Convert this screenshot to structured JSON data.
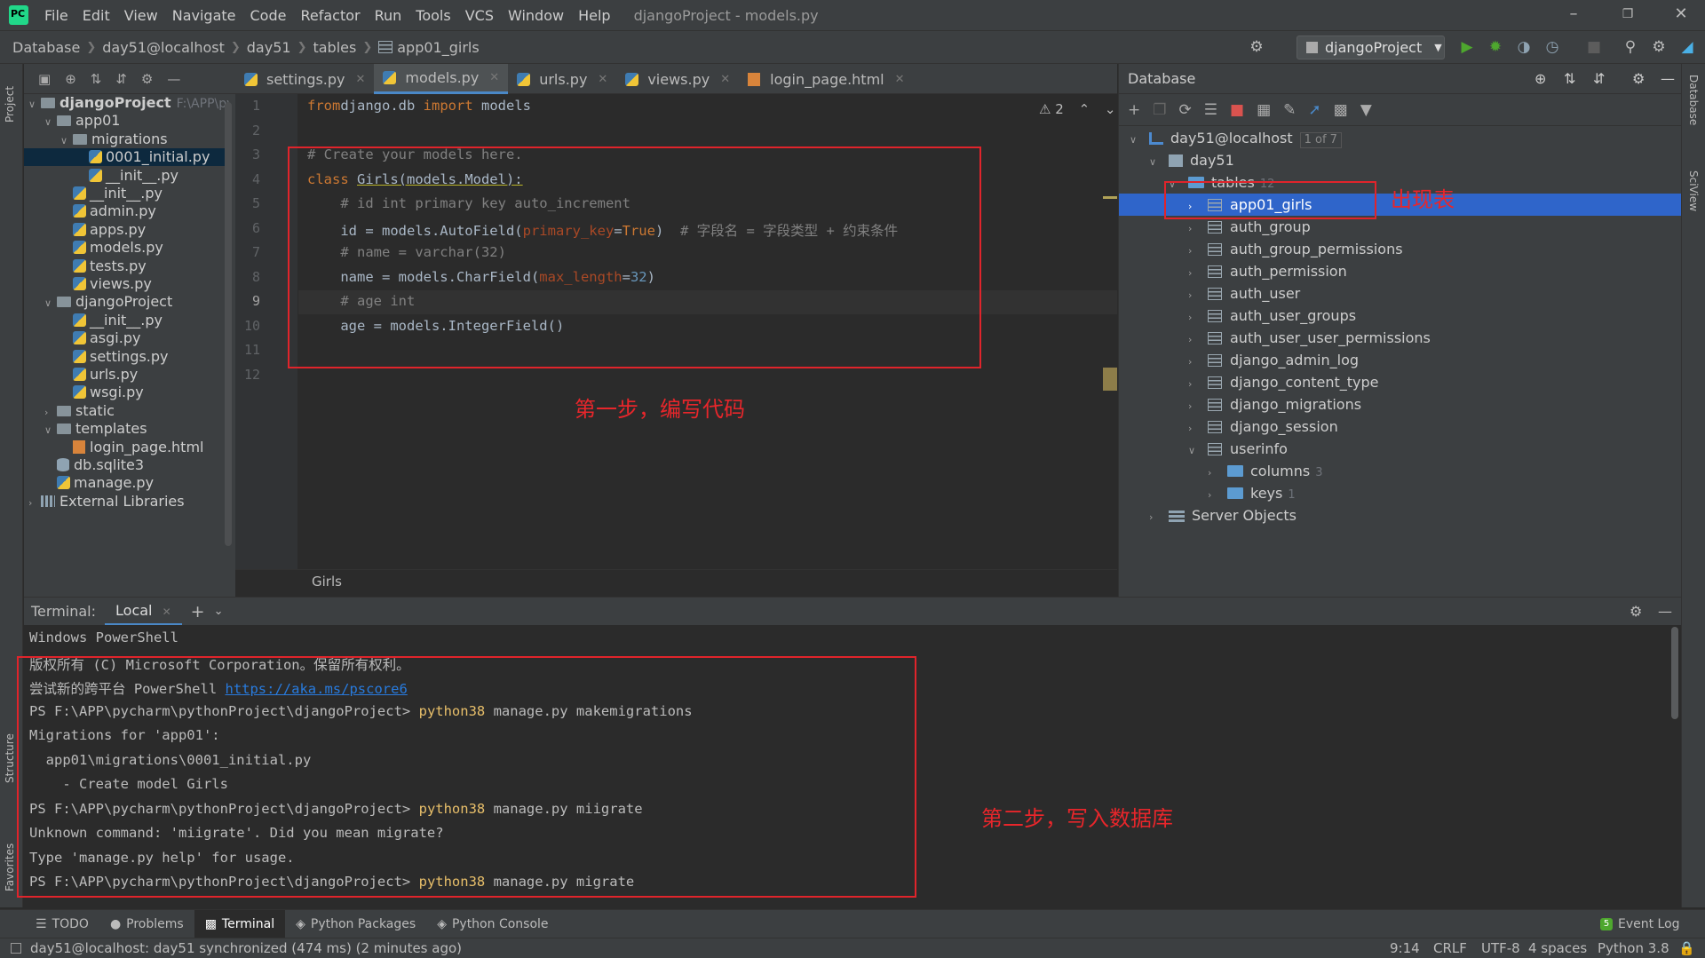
{
  "app": {
    "menu": [
      "File",
      "Edit",
      "View",
      "Navigate",
      "Code",
      "Refactor",
      "Run",
      "Tools",
      "VCS",
      "Window",
      "Help"
    ],
    "window_title": "djangoProject - models.py"
  },
  "navbar": {
    "crumbs": [
      "Database",
      "day51@localhost",
      "day51",
      "tables",
      "app01_girls"
    ],
    "run_config": "djangoProject"
  },
  "left_stripe": {
    "project": "Project",
    "structure": "Structure",
    "favorites": "Favorites"
  },
  "right_stripe": {
    "database": "Database",
    "sciview": "SciView"
  },
  "project_tree": [
    {
      "label": "djangoProject",
      "suffix": "F:\\APP\\py",
      "icon": "folder-icon",
      "arrow": "v",
      "indent": 0,
      "bold": true
    },
    {
      "label": "app01",
      "icon": "folder-icon",
      "arrow": "v",
      "indent": 1
    },
    {
      "label": "migrations",
      "icon": "folder-icon",
      "arrow": "v",
      "indent": 2
    },
    {
      "label": "0001_initial.py",
      "icon": "python-file-icon",
      "arrow": "",
      "indent": 3,
      "selected": true
    },
    {
      "label": "__init__.py",
      "icon": "python-file-icon",
      "arrow": "",
      "indent": 3
    },
    {
      "label": "__init__.py",
      "icon": "python-file-icon",
      "arrow": "",
      "indent": 2
    },
    {
      "label": "admin.py",
      "icon": "python-file-icon",
      "arrow": "",
      "indent": 2
    },
    {
      "label": "apps.py",
      "icon": "python-file-icon",
      "arrow": "",
      "indent": 2
    },
    {
      "label": "models.py",
      "icon": "python-file-icon",
      "arrow": "",
      "indent": 2
    },
    {
      "label": "tests.py",
      "icon": "python-file-icon",
      "arrow": "",
      "indent": 2
    },
    {
      "label": "views.py",
      "icon": "python-file-icon",
      "arrow": "",
      "indent": 2
    },
    {
      "label": "djangoProject",
      "icon": "folder-icon",
      "arrow": "v",
      "indent": 1
    },
    {
      "label": "__init__.py",
      "icon": "python-file-icon",
      "arrow": "",
      "indent": 2
    },
    {
      "label": "asgi.py",
      "icon": "python-file-icon",
      "arrow": "",
      "indent": 2
    },
    {
      "label": "settings.py",
      "icon": "python-file-icon",
      "arrow": "",
      "indent": 2
    },
    {
      "label": "urls.py",
      "icon": "python-file-icon",
      "arrow": "",
      "indent": 2
    },
    {
      "label": "wsgi.py",
      "icon": "python-file-icon",
      "arrow": "",
      "indent": 2
    },
    {
      "label": "static",
      "icon": "folder-icon",
      "arrow": ">",
      "indent": 1
    },
    {
      "label": "templates",
      "icon": "folder-icon",
      "arrow": "v",
      "indent": 1
    },
    {
      "label": "login_page.html",
      "icon": "html-file-icon",
      "arrow": "",
      "indent": 2
    },
    {
      "label": "db.sqlite3",
      "icon": "database-file-icon",
      "arrow": "",
      "indent": 1
    },
    {
      "label": "manage.py",
      "icon": "python-file-icon",
      "arrow": "",
      "indent": 1
    },
    {
      "label": "External Libraries",
      "icon": "library-icon",
      "arrow": ">",
      "indent": 0
    }
  ],
  "editor": {
    "tabs": [
      {
        "label": "settings.py",
        "active": false
      },
      {
        "label": "models.py",
        "active": true
      },
      {
        "label": "urls.py",
        "active": false
      },
      {
        "label": "views.py",
        "active": false
      },
      {
        "label": "login_page.html",
        "active": false
      }
    ],
    "warning_count": "2",
    "current_line": "9",
    "breadcrumb": "Girls",
    "lines": [
      {
        "n": "1",
        "parts": [
          [
            "kw",
            "from"
          ],
          [
            "",
            "django.db "
          ],
          [
            "kw",
            "import"
          ],
          [
            "",
            " models"
          ]
        ]
      },
      {
        "n": "2",
        "parts": []
      },
      {
        "n": "3",
        "parts": [
          [
            "cm",
            "# Create your models here."
          ]
        ]
      },
      {
        "n": "4",
        "parts": [
          [
            "kw",
            "class "
          ],
          [
            "cls",
            "Girls(models.Model):"
          ]
        ]
      },
      {
        "n": "5",
        "parts": [
          [
            "cm",
            "    # id int primary key auto_increment"
          ]
        ]
      },
      {
        "n": "6",
        "parts": [
          [
            "",
            "    id = models.AutoField("
          ],
          [
            "param",
            "primary_key"
          ],
          [
            "",
            "="
          ],
          [
            "kw",
            "True"
          ],
          [
            "",
            ")  "
          ],
          [
            "cm",
            "# 字段名 = 字段类型 + 约束条件"
          ]
        ]
      },
      {
        "n": "7",
        "parts": [
          [
            "cm",
            "    # name = varchar(32)"
          ]
        ]
      },
      {
        "n": "8",
        "parts": [
          [
            "",
            "    name = models.CharField("
          ],
          [
            "param",
            "max_length"
          ],
          [
            "",
            "="
          ],
          [
            "num",
            "32"
          ],
          [
            "",
            ")"
          ]
        ]
      },
      {
        "n": "9",
        "parts": [
          [
            "cm",
            "    # age int"
          ]
        ]
      },
      {
        "n": "10",
        "parts": [
          [
            "",
            "    age = models.IntegerField()"
          ]
        ]
      },
      {
        "n": "11",
        "parts": []
      },
      {
        "n": "12",
        "parts": []
      }
    ]
  },
  "annotations": {
    "step1": "第一步，编写代码",
    "step2": "第二步，写入数据库",
    "table_appears": "出现表"
  },
  "database": {
    "title": "Database",
    "tree": [
      {
        "label": "day51@localhost",
        "badge": "1 of 7",
        "icon": "connection-icon",
        "arrow": "v",
        "level": 0
      },
      {
        "label": "day51",
        "icon": "schema-icon",
        "arrow": "v",
        "level": 1
      },
      {
        "label": "tables",
        "count": "12",
        "icon": "folder-icon",
        "arrow": "v",
        "level": 2
      },
      {
        "label": "app01_girls",
        "icon": "table-icon",
        "arrow": ">",
        "level": 3,
        "selected": true
      },
      {
        "label": "auth_group",
        "icon": "table-icon",
        "arrow": ">",
        "level": 3
      },
      {
        "label": "auth_group_permissions",
        "icon": "table-icon",
        "arrow": ">",
        "level": 3
      },
      {
        "label": "auth_permission",
        "icon": "table-icon",
        "arrow": ">",
        "level": 3
      },
      {
        "label": "auth_user",
        "icon": "table-icon",
        "arrow": ">",
        "level": 3
      },
      {
        "label": "auth_user_groups",
        "icon": "table-icon",
        "arrow": ">",
        "level": 3
      },
      {
        "label": "auth_user_user_permissions",
        "icon": "table-icon",
        "arrow": ">",
        "level": 3
      },
      {
        "label": "django_admin_log",
        "icon": "table-icon",
        "arrow": ">",
        "level": 3
      },
      {
        "label": "django_content_type",
        "icon": "table-icon",
        "arrow": ">",
        "level": 3
      },
      {
        "label": "django_migrations",
        "icon": "table-icon",
        "arrow": ">",
        "level": 3
      },
      {
        "label": "django_session",
        "icon": "table-icon",
        "arrow": ">",
        "level": 3
      },
      {
        "label": "userinfo",
        "icon": "table-icon",
        "arrow": "v",
        "level": 3
      },
      {
        "label": "columns",
        "count": "3",
        "icon": "folder-icon",
        "arrow": ">",
        "level": 4
      },
      {
        "label": "keys",
        "count": "1",
        "icon": "folder-icon",
        "arrow": ">",
        "level": 4
      },
      {
        "label": "Server Objects",
        "icon": "server-icon",
        "arrow": ">",
        "level": 1
      }
    ]
  },
  "terminal": {
    "label": "Terminal:",
    "tab": "Local",
    "lines": [
      [
        [
          "",
          "Windows PowerShell"
        ]
      ],
      [
        [
          "",
          "版权所有 (C) Microsoft Corporation。保留所有权利。"
        ]
      ],
      [
        [
          "",
          "尝试新的跨平台 PowerShell "
        ],
        [
          "link",
          "https://aka.ms/pscore6"
        ]
      ],
      [
        [
          "",
          "PS F:\\APP\\pycharm\\pythonProject\\djangoProject> "
        ],
        [
          "py",
          "python38"
        ],
        [
          "",
          " manage.py makemigrations"
        ]
      ],
      [
        [
          "",
          "Migrations for 'app01':"
        ]
      ],
      [
        [
          "",
          "  app01\\migrations\\0001_initial.py"
        ]
      ],
      [
        [
          "",
          "    - Create model Girls"
        ]
      ],
      [
        [
          "",
          "PS F:\\APP\\pycharm\\pythonProject\\djangoProject> "
        ],
        [
          "py",
          "python38"
        ],
        [
          "",
          " manage.py miigrate"
        ]
      ],
      [
        [
          "",
          "Unknown command: 'miigrate'. Did you mean migrate?"
        ]
      ],
      [
        [
          "",
          "Type 'manage.py help' for usage."
        ]
      ],
      [
        [
          "",
          "PS F:\\APP\\pycharm\\pythonProject\\djangoProject> "
        ],
        [
          "py",
          "python38"
        ],
        [
          "",
          " manage.py migrate"
        ]
      ]
    ]
  },
  "toolwindows": {
    "todo": "TODO",
    "problems": "Problems",
    "terminal": "Terminal",
    "python_packages": "Python Packages",
    "python_console": "Python Console",
    "event_log": "Event Log"
  },
  "status": {
    "message": "day51@localhost: day51 synchronized (474 ms) (2 minutes ago)",
    "position": "9:14",
    "line_sep": "CRLF",
    "encoding": "UTF-8",
    "indent": "4 spaces",
    "interpreter": "Python 3.8"
  },
  "colors": {
    "accent": "#4a88c7",
    "selection_db": "#2f65ca",
    "annotation": "#e0242b"
  }
}
